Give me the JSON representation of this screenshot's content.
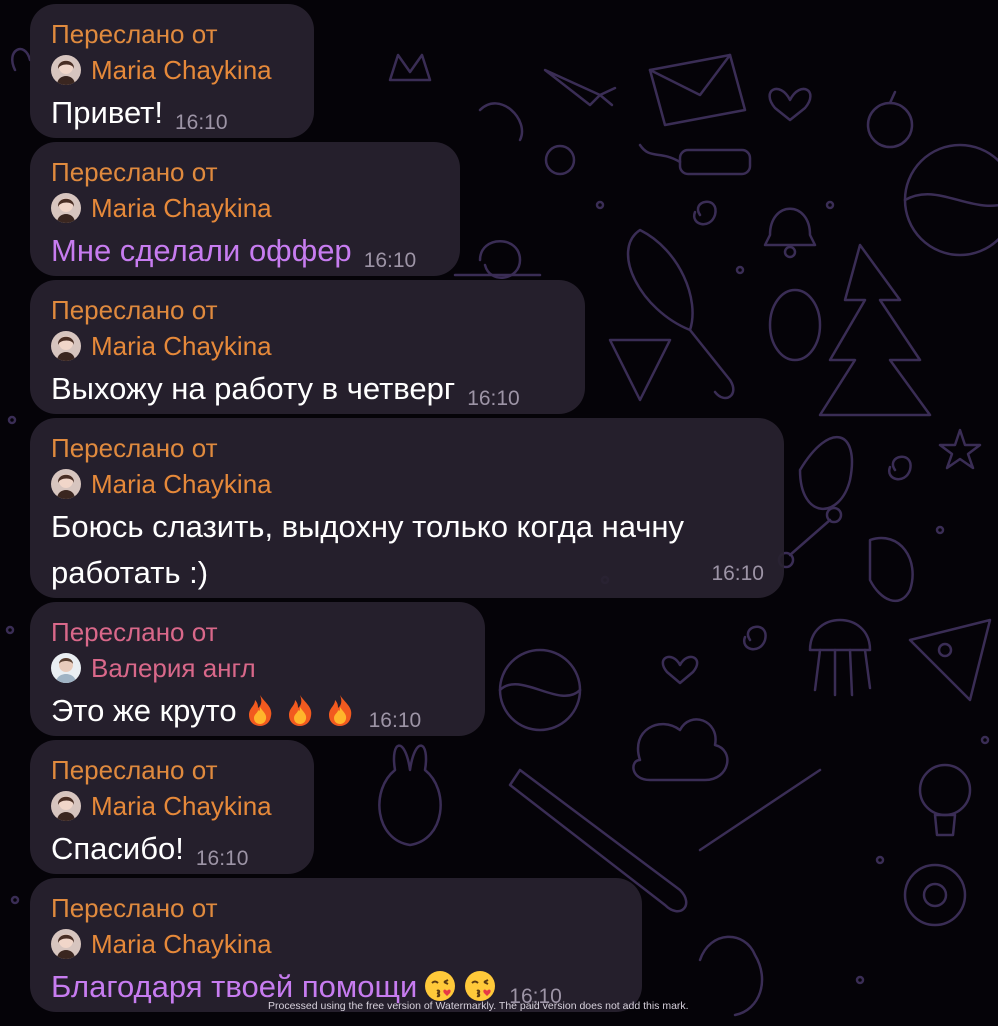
{
  "messages": [
    {
      "forwarded_label": "Переслано от",
      "sender": "Maria Chaykina",
      "text": "Привет!",
      "time": "16:10"
    },
    {
      "forwarded_label": "Переслано от",
      "sender": "Maria Chaykina",
      "text": "Мне сделали оффер",
      "time": "16:10"
    },
    {
      "forwarded_label": "Переслано от",
      "sender": "Maria Chaykina",
      "text": "Выхожу на работу в четверг",
      "time": "16:10"
    },
    {
      "forwarded_label": "Переслано от",
      "sender": "Maria Chaykina",
      "text": "Боюсь слазить, выдохну только когда начну работать :)",
      "time": "16:10"
    },
    {
      "forwarded_label": "Переслано от",
      "sender": "Валерия англ",
      "text": "Это же круто",
      "time": "16:10",
      "emoji": [
        "fire-emoji",
        "fire-emoji",
        "fire-emoji"
      ]
    },
    {
      "forwarded_label": "Переслано от",
      "sender": "Maria Chaykina",
      "text": "Спасибо!",
      "time": "16:10"
    },
    {
      "forwarded_label": "Переслано от",
      "sender": "Maria Chaykina",
      "text": "Благодаря твоей помощи",
      "time": "16:10",
      "emoji": [
        "kiss-emoji",
        "kiss-emoji"
      ]
    }
  ],
  "watermark": "Processed using the free version of Watermarkly. The paid version does not add this mark.",
  "colors": {
    "background": "#050308",
    "bubble": "#28212f",
    "forwarded_label": "#e08a3e",
    "sender_name": "#e6893a",
    "sender_name_alt": "#d9688a",
    "highlight_text": "#c77cf0",
    "time": "#9d94a6",
    "wallpaper_doodle": "#3a2d55"
  }
}
